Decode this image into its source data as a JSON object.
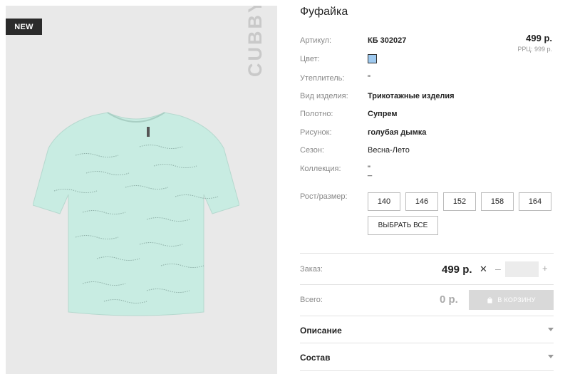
{
  "badge": {
    "label": "NEW"
  },
  "brand": {
    "name": "CUBBY"
  },
  "product": {
    "title": "Фуфайка",
    "price": "499 р.",
    "rrp": "РРЦ: 999 р."
  },
  "specs": [
    {
      "label": "Артикул:",
      "value": "КБ 302027",
      "bold": true
    },
    {
      "label": "Цвет:",
      "swatch_color": "#9ec9ef"
    },
    {
      "label": "Утеплитель:",
      "value": "\"",
      "bold": false
    },
    {
      "label": "Вид изделия:",
      "value": "Трикотажные изделия",
      "bold": true
    },
    {
      "label": "Полотно:",
      "value": "Супрем",
      "bold": true
    },
    {
      "label": "Рисунок:",
      "value": "голубая дымка",
      "bold": true
    },
    {
      "label": "Сезон:",
      "value": "Весна-Лето",
      "bold": false
    },
    {
      "label": "Коллекция:",
      "value": "\"",
      "value2": "_",
      "bold": false
    }
  ],
  "sizes": {
    "label": "Рост/размер:",
    "options": [
      "140",
      "146",
      "152",
      "158",
      "164"
    ],
    "select_all": "ВЫБРАТЬ ВСЕ"
  },
  "order": {
    "label": "Заказ:",
    "price": "499 р.",
    "times": "✕",
    "minus": "–",
    "quantity": "",
    "plus": "+"
  },
  "total": {
    "label": "Всего:",
    "value": "0 р.",
    "cart_button": "В КОРЗИНУ"
  },
  "accordions": [
    {
      "title": "Описание"
    },
    {
      "title": "Состав"
    }
  ],
  "colors": {
    "tshirt": "#c7ebe2",
    "badge_bg": "#2b2b2b",
    "cart_button_bg": "#d9d9d9"
  }
}
